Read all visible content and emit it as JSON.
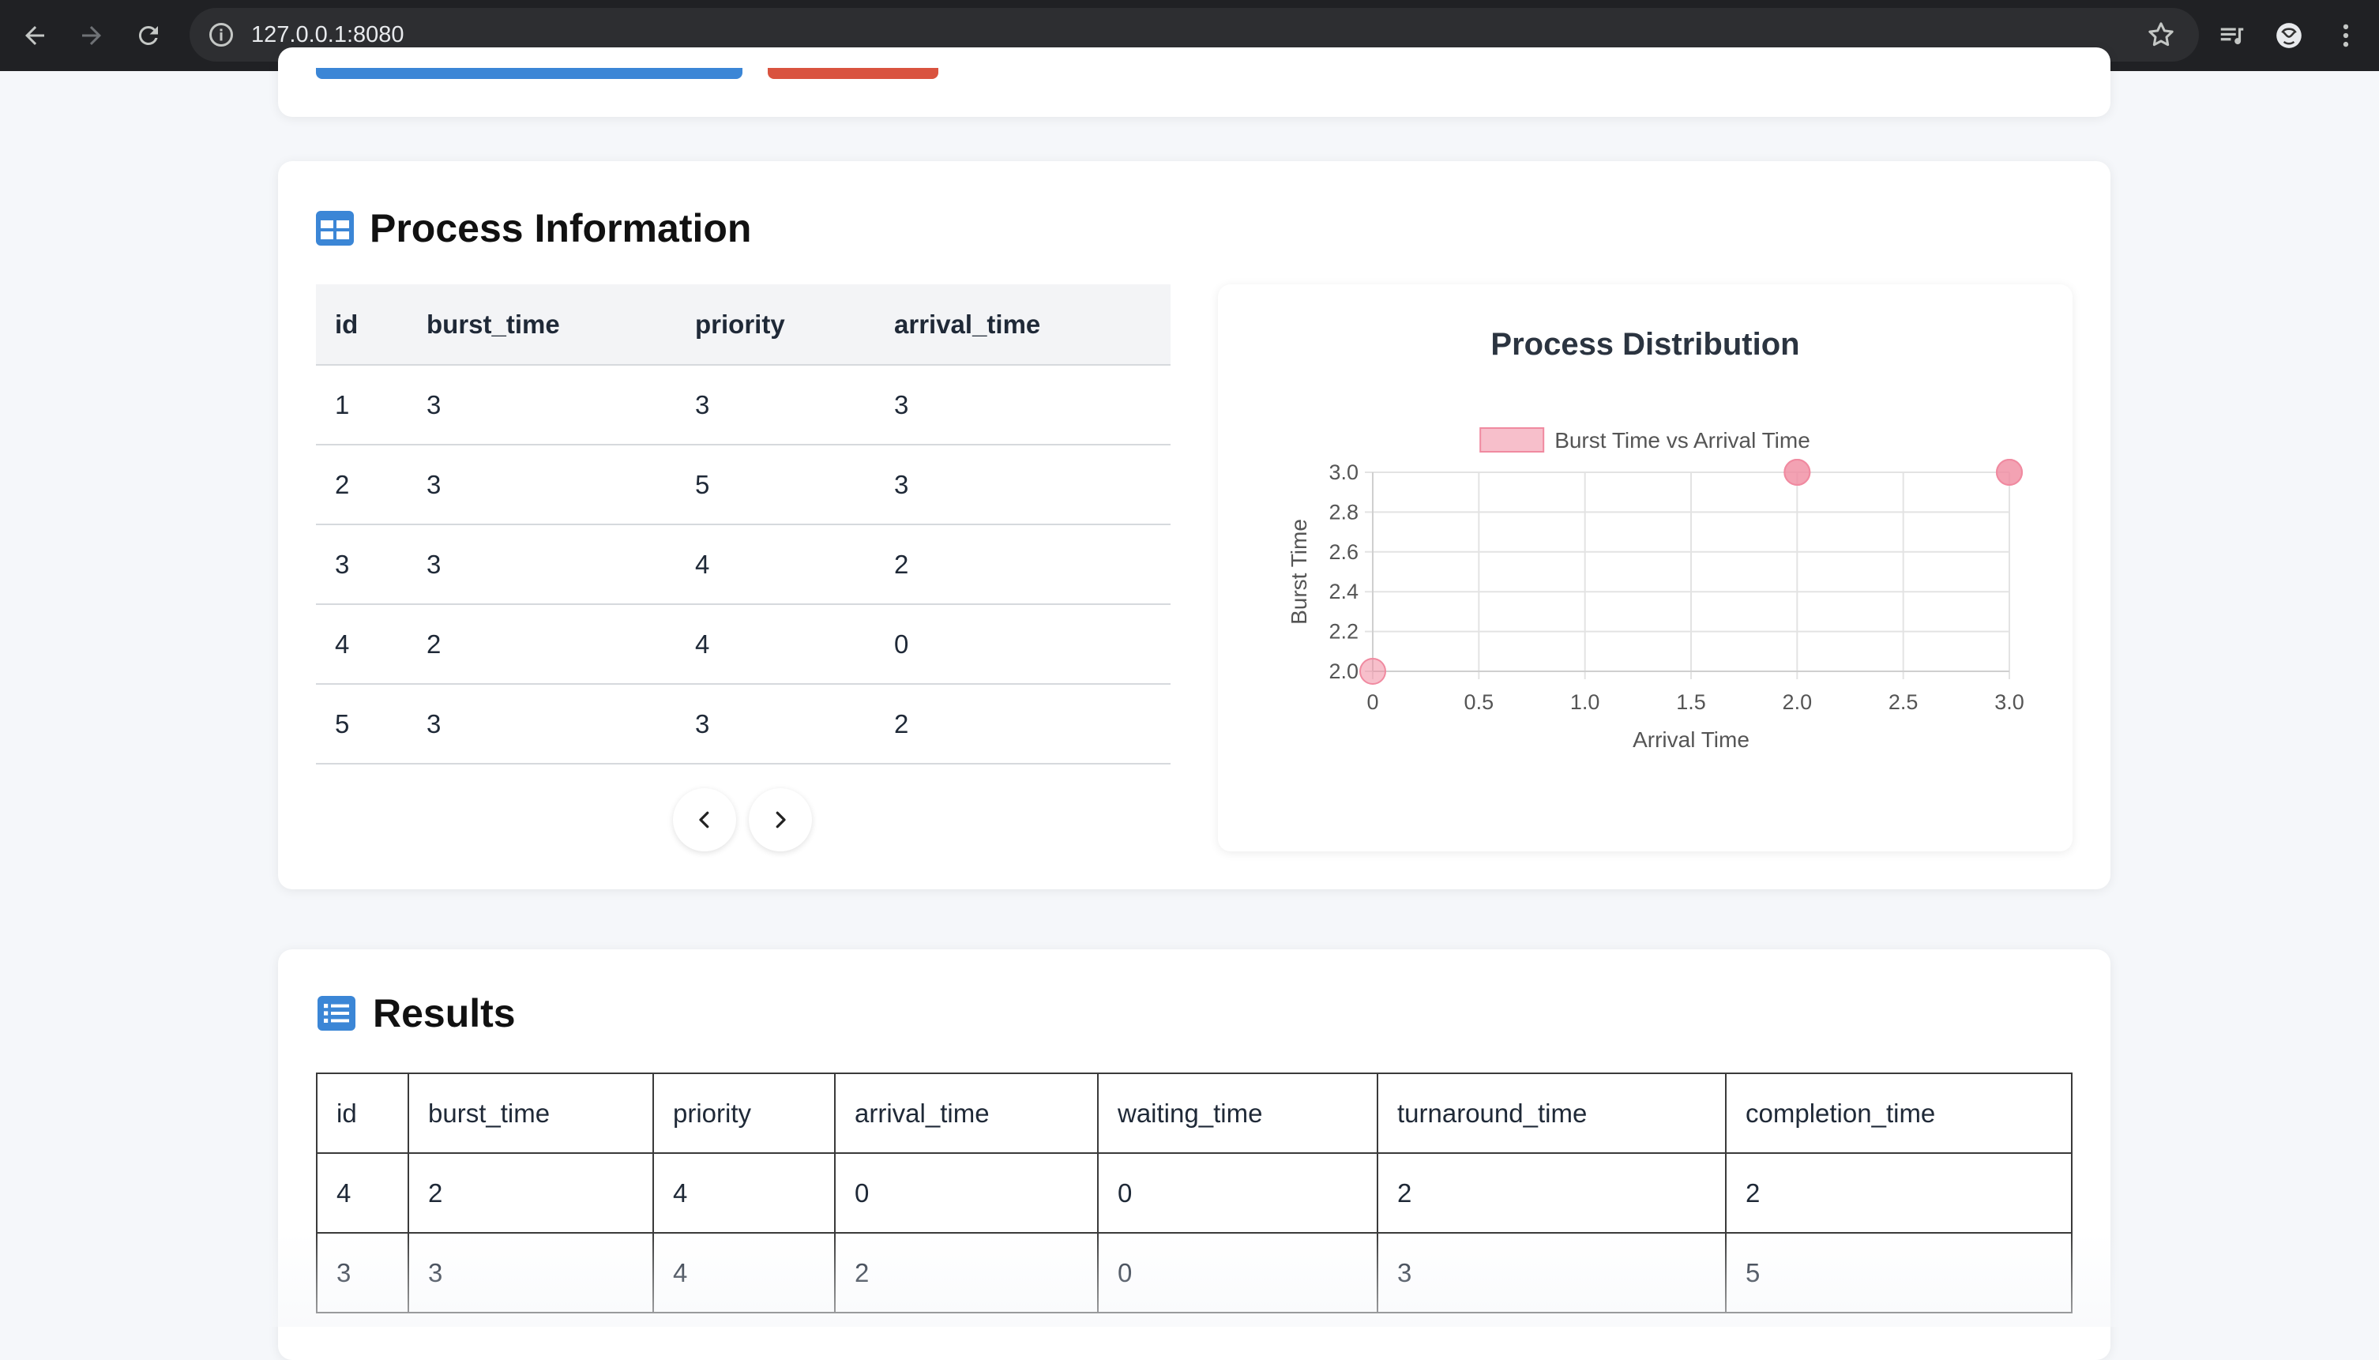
{
  "browser": {
    "url": "127.0.0.1:8080"
  },
  "process_section": {
    "title": "Process Information",
    "table": {
      "columns": [
        "id",
        "burst_time",
        "priority",
        "arrival_time"
      ],
      "rows": [
        [
          "1",
          "3",
          "3",
          "3"
        ],
        [
          "2",
          "3",
          "5",
          "3"
        ],
        [
          "3",
          "3",
          "4",
          "2"
        ],
        [
          "4",
          "2",
          "4",
          "0"
        ],
        [
          "5",
          "3",
          "3",
          "2"
        ]
      ]
    }
  },
  "chart_data": {
    "type": "scatter",
    "title": "Process Distribution",
    "xlabel": "Arrival Time",
    "ylabel": "Burst Time",
    "xlim": [
      0,
      3.0
    ],
    "ylim": [
      2.0,
      3.0
    ],
    "x_ticks": [
      "0",
      "0.5",
      "1.0",
      "1.5",
      "2.0",
      "2.5",
      "3.0"
    ],
    "y_ticks": [
      "2.0",
      "2.2",
      "2.4",
      "2.6",
      "2.8",
      "3.0"
    ],
    "legend_position": "top",
    "grid": true,
    "series": [
      {
        "name": "Burst Time vs Arrival Time",
        "color": "#f08aa0",
        "points": [
          {
            "x": 3,
            "y": 3
          },
          {
            "x": 3,
            "y": 3
          },
          {
            "x": 2,
            "y": 3
          },
          {
            "x": 0,
            "y": 2
          },
          {
            "x": 2,
            "y": 3
          }
        ]
      }
    ]
  },
  "results_section": {
    "title": "Results",
    "table": {
      "columns": [
        "id",
        "burst_time",
        "priority",
        "arrival_time",
        "waiting_time",
        "turnaround_time",
        "completion_time"
      ],
      "rows": [
        [
          "4",
          "2",
          "4",
          "0",
          "0",
          "2",
          "2"
        ],
        [
          "3",
          "3",
          "4",
          "2",
          "0",
          "3",
          "5"
        ]
      ]
    }
  },
  "colors": {
    "accent_blue": "#3b86d6",
    "accent_red": "#d9533f",
    "point_pink": "#f08aa0"
  }
}
